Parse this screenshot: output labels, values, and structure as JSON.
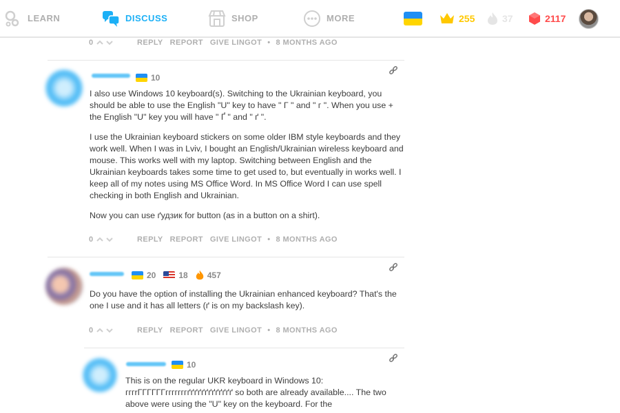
{
  "nav": {
    "learn": "LEARN",
    "discuss": "DISCUSS",
    "shop": "SHOP",
    "more": "MORE"
  },
  "stats": {
    "crowns": "255",
    "streak": "37",
    "gems": "2117"
  },
  "colors": {
    "accent": "#1cb0f6",
    "crown": "#ffc800",
    "gem": "#ff4b4b",
    "muted": "#afafaf"
  },
  "action_labels": {
    "reply": "REPLY",
    "report": "REPORT",
    "give_lingot": "GIVE LINGOT",
    "separator": "•"
  },
  "top_action": {
    "votes": "0",
    "time": "8 MONTHS AGO"
  },
  "comments": [
    {
      "level": "10",
      "paragraphs": [
        "I also use Windows 10 keyboard(s). Switching to the Ukrainian keyboard, you should be able to use the English \"U\" key to have \" Г \" and \" г \". When you use + the English \"U\" key you will have \" Ґ \" and \" ґ \".",
        "I use the Ukrainian keyboard stickers on some older IBM style keyboards and they work well. When I was in Lviv, I bought an English/Ukrainian wireless keyboard and mouse. This works well with my laptop. Switching between English and the Ukrainian keyboards takes some time to get used to, but eventually in works well. I keep all of my notes using MS Office Word. In MS Office Word I can use spell checking in both English and Ukrainian.",
        "Now you can use ґудзик for button (as in a button on a shirt)."
      ],
      "votes": "0",
      "time": "8 MONTHS AGO"
    },
    {
      "level_ua": "20",
      "level_us": "18",
      "streak": "457",
      "paragraphs": [
        "Do you have the option of installing the Ukrainian enhanced keyboard? That's the one I use and it has all letters (ґ is on my backslash key)."
      ],
      "votes": "0",
      "time": "8 MONTHS AGO"
    },
    {
      "level": "10",
      "paragraphs": [
        "This is on the regular UKR keyboard in Windows 10: гггrГГГГГГгггггггґґґґґґґґґґґґґ so both are already available.... The two above were using the \"U\" key on the keyboard. For the"
      ]
    }
  ]
}
